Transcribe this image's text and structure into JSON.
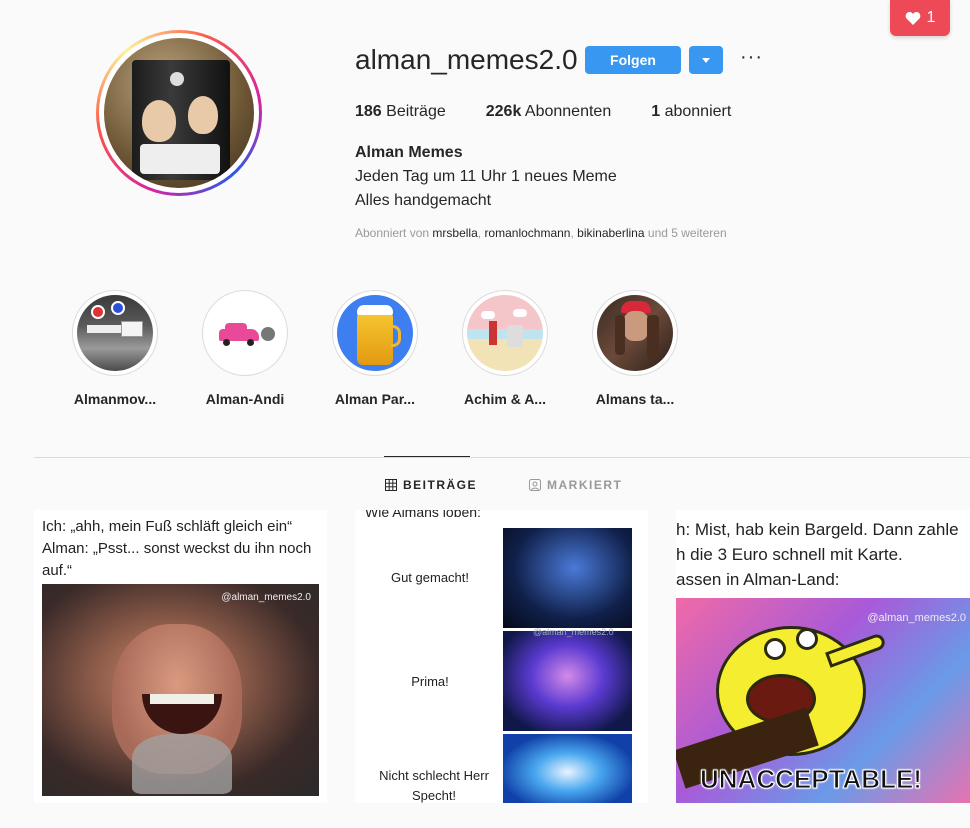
{
  "notification": {
    "count": "1",
    "icon": "heart-icon"
  },
  "profile": {
    "username": "alman_memes2.0",
    "follow_label": "Folgen",
    "stats": [
      {
        "value": "186",
        "label": "Beiträge"
      },
      {
        "value": "226k",
        "label": "Abonnenten"
      },
      {
        "value": "1",
        "label": "abonniert"
      }
    ],
    "bio_name": "Alman Memes",
    "bio_lines": [
      "Jeden Tag um 11 Uhr 1 neues Meme",
      "Alles handgemacht"
    ],
    "followed_by": {
      "prefix": "Abonniert von",
      "users": [
        "mrsbella",
        "romanlochmann",
        "bikinaberlina"
      ],
      "suffix": "und 5 weiteren"
    }
  },
  "highlights": [
    {
      "label": "Almanmov..."
    },
    {
      "label": "Alman-Andi"
    },
    {
      "label": "Alman Par..."
    },
    {
      "label": "Achim & A..."
    },
    {
      "label": "Almans ta..."
    }
  ],
  "tabs": {
    "posts": "BEITRÄGE",
    "tagged": "MARKIERT"
  },
  "posts": [
    {
      "caption_1": "Ich: „ahh, mein Fuß schläft gleich ein“",
      "caption_2": "Alman: „Psst... sonst weckst du ihn noch",
      "caption_3": "auf.“",
      "watermark": "@alman_memes2.0"
    },
    {
      "header": "Wie Almans loben:",
      "rows": [
        "Gut gemacht!",
        "Prima!",
        "Nicht schlecht Herr Specht!"
      ],
      "watermark": "@alman_memes2.0"
    },
    {
      "line_1": "h: Mist, hab kein Bargeld. Dann zahle",
      "line_2": "h die 3 Euro schnell mit Karte.",
      "line_3": "assen in Alman-Land:",
      "watermark": "@alman_memes2.0",
      "bottom": "UNACCEPTABLE!"
    }
  ]
}
